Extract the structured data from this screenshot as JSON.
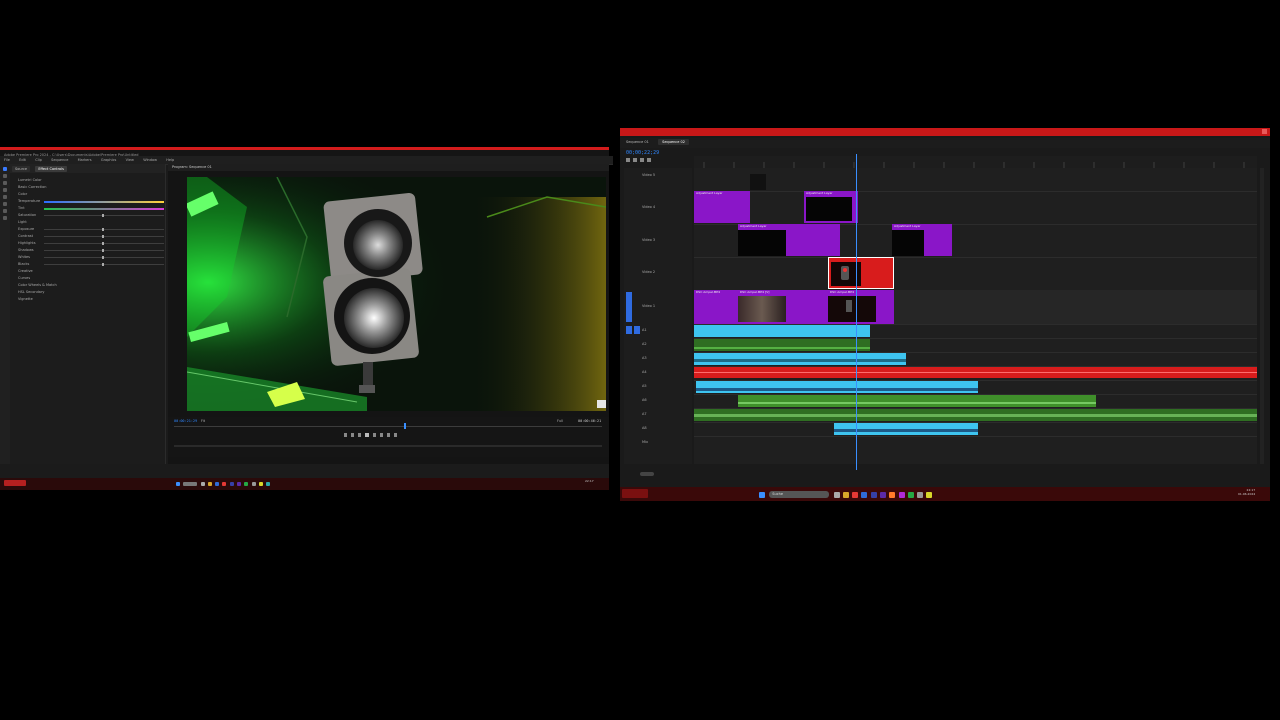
{
  "left_window": {
    "title": "Adobe Premiere Pro 2024 - C:\\Users\\Documents\\Adobe\\Premiere Pro\\Untitled",
    "menu": [
      "File",
      "Edit",
      "Clip",
      "Sequence",
      "Markers",
      "Graphics",
      "View",
      "Window",
      "Help"
    ],
    "effect_tabs": [
      "Source",
      "Effect Controls"
    ],
    "effect_rows": [
      "Lumetri Color",
      "Basic Correction",
      "Color",
      "Temperature",
      "Tint",
      "Saturation",
      "Light",
      "Exposure",
      "Contrast",
      "Highlights",
      "Shadows",
      "Whites",
      "Blacks",
      "Creative",
      "Curves",
      "Color Wheels & Match",
      "HSL Secondary",
      "Vignette"
    ],
    "program_monitor": "Program: Sequence 01",
    "timecode_left": "00:00:21:29",
    "zoom": "Fit",
    "quality": "Full",
    "timecode_right": "00:00:46:21"
  },
  "right_window": {
    "sequence_tabs": [
      "Sequence 01",
      "Sequence 02"
    ],
    "timecode": "00;00;22;29",
    "video_tracks": [
      {
        "id": "V5",
        "label": "Video 5"
      },
      {
        "id": "V4",
        "label": "Video 4"
      },
      {
        "id": "V3",
        "label": "Video 3"
      },
      {
        "id": "V2",
        "label": "Video 2"
      },
      {
        "id": "V1",
        "label": "Video 1"
      }
    ],
    "audio_tracks": [
      "A1",
      "A2",
      "A3",
      "A4",
      "A5",
      "A6",
      "A7",
      "A8"
    ],
    "clips": {
      "adj1": "Adjustment Layer",
      "adj2": "Adjustment Layer",
      "adj3": "Adjustment Layer",
      "adj4": "Adjustment Layer",
      "v1a": "DSC Ampel.MP4",
      "v1b": "DSC Ampel.MP4 [V]",
      "v1c": "DSC Ampel.MP4"
    },
    "master": "Mix"
  },
  "taskbar": {
    "search_label": "Suche",
    "clock_time": "22:17",
    "clock_date": "01.06.2024"
  },
  "colors": {
    "accent_red": "#c81818",
    "clip_purple": "#8a16c8",
    "clip_cyan": "#3ec4f0",
    "clip_green": "#3f8f2a",
    "clip_red": "#d81c1c",
    "playhead": "#3a8fff"
  }
}
